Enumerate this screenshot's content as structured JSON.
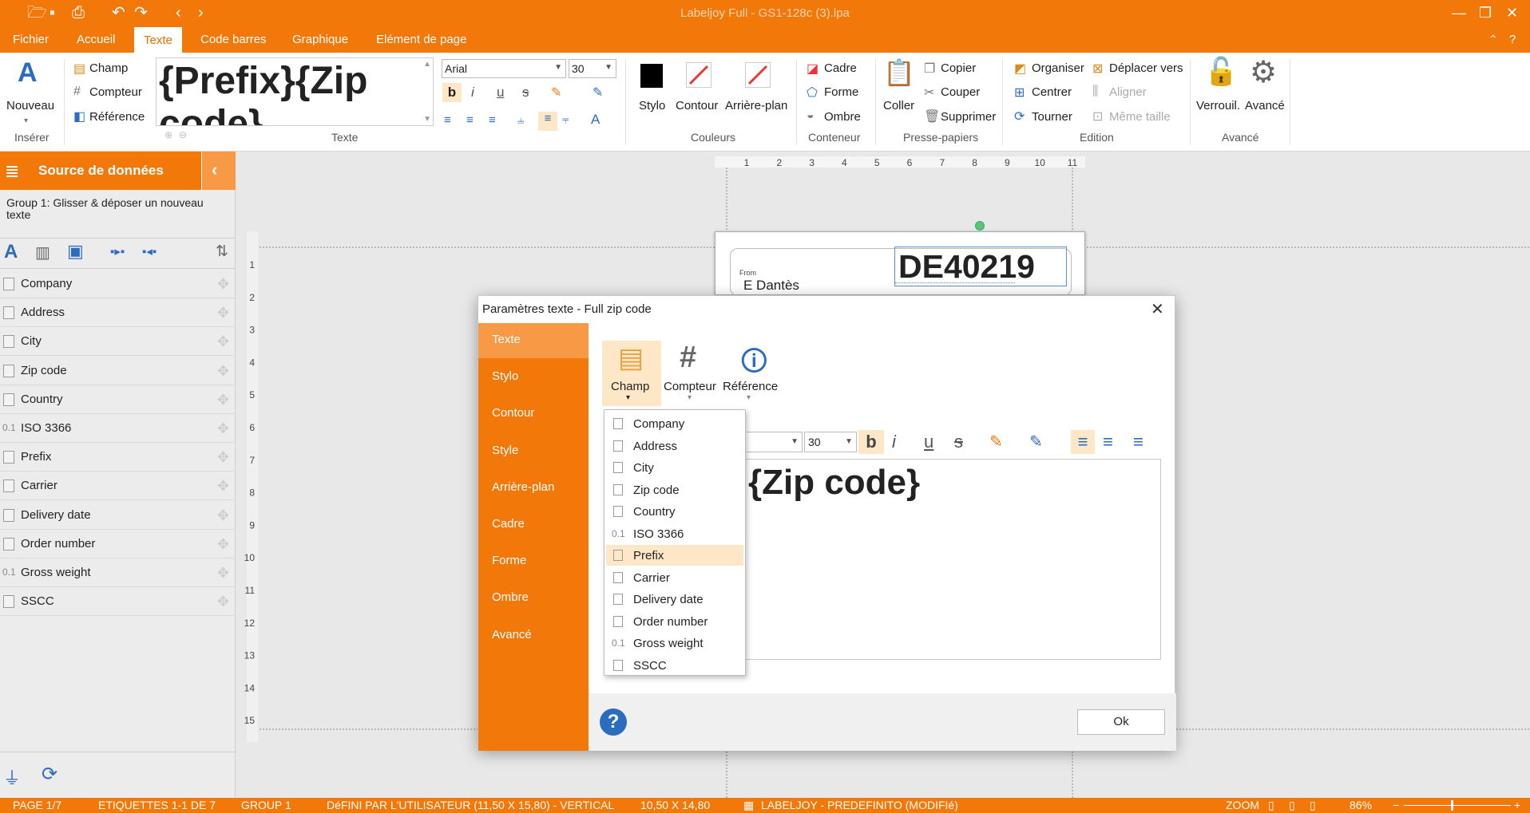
{
  "app": {
    "title": "Labeljoy Full - GS1-128c (3).lpa",
    "ribbon_tabs": [
      "Fichier",
      "Accueil",
      "Texte",
      "Code barres",
      "Graphique",
      "Elément de page"
    ],
    "active_tab": "Texte"
  },
  "ribbon": {
    "insert": {
      "nouveau": "Nouveau",
      "group": "Insérer"
    },
    "fields": {
      "champ": "Champ",
      "compteur": "Compteur",
      "reference": "Référence"
    },
    "texte": {
      "preview": "{Prefix}{Zip code}",
      "group": "Texte"
    },
    "font": {
      "name": "Arial",
      "size": "30"
    },
    "couleurs": {
      "stylo": "Stylo",
      "contour": "Contour",
      "arriere_plan": "Arrière-plan",
      "group": "Couleurs"
    },
    "conteneur": {
      "cadre": "Cadre",
      "forme": "Forme",
      "ombre": "Ombre",
      "group": "Conteneur"
    },
    "presse_papiers": {
      "coller": "Coller",
      "copier": "Copier",
      "couper": "Couper",
      "supprimer": "Supprimer",
      "group": "Presse-papiers"
    },
    "edition": {
      "organiser": "Organiser",
      "deplacer": "Déplacer vers",
      "centrer": "Centrer",
      "aligner": "Aligner",
      "tourner": "Tourner",
      "meme_taille": "Même taille",
      "group": "Edition"
    },
    "avance": {
      "verrouil": "Verrouil.",
      "avance": "Avancé",
      "group": "Avancé"
    }
  },
  "left_panel": {
    "title": "Source de données",
    "group_hint": "Group 1: Glisser & déposer un nouveau texte",
    "fields": [
      {
        "label": "Company",
        "icon": "field-icon"
      },
      {
        "label": "Address",
        "icon": "field-icon"
      },
      {
        "label": "City",
        "icon": "field-icon"
      },
      {
        "label": "Zip code",
        "icon": "field-icon"
      },
      {
        "label": "Country",
        "icon": "field-icon"
      },
      {
        "label": "ISO 3366",
        "icon": "0.1"
      },
      {
        "label": "Prefix",
        "icon": "field-icon"
      },
      {
        "label": "Carrier",
        "icon": "field-icon"
      },
      {
        "label": "Delivery date",
        "icon": "date-icon"
      },
      {
        "label": "Order number",
        "icon": "field-icon"
      },
      {
        "label": "Gross weight",
        "icon": "0.1"
      },
      {
        "label": "SSCC",
        "icon": "field-icon"
      }
    ]
  },
  "canvas": {
    "ruler_h": [
      "1",
      "2",
      "3",
      "4",
      "5",
      "6",
      "7",
      "8",
      "9",
      "10",
      "11"
    ],
    "ruler_v": [
      "1",
      "2",
      "3",
      "4",
      "5",
      "6",
      "7",
      "8",
      "9",
      "10",
      "11",
      "12",
      "13",
      "14",
      "15"
    ],
    "label": {
      "from_caption": "From",
      "sender": "E Dantès",
      "zip_value": "DE40219"
    }
  },
  "dialog": {
    "title": "Paramètres texte - Full zip code",
    "sidebar": [
      "Texte",
      "Stylo",
      "Contour",
      "Style",
      "Arrière-plan",
      "Cadre",
      "Forme",
      "Ombre",
      "Avancé"
    ],
    "selected_sidebar": "Texte",
    "toolbar": {
      "champ": "Champ",
      "compteur": "Compteur",
      "reference": "Référence"
    },
    "font_size": "30",
    "editor_text": "{Zip code}",
    "dropdown": [
      "Company",
      "Address",
      "City",
      "Zip code",
      "Country",
      "ISO 3366",
      "Prefix",
      "Carrier",
      "Delivery date",
      "Order number",
      "Gross weight",
      "SSCC"
    ],
    "dropdown_icons": [
      "field",
      "field",
      "field",
      "field",
      "field",
      "0.1",
      "field",
      "field",
      "date",
      "field",
      "0.1",
      "field"
    ],
    "dropdown_highlight": "Prefix",
    "ok_label": "Ok"
  },
  "status": {
    "page": "PAGE 1/7",
    "etiquettes": "ETIQUETTES 1-1 DE 7",
    "group": "GROUP 1",
    "defini": "DéFINI PAR L'UTILISATEUR (11,50 X 15,80) - VERTICAL",
    "size": "10,50 X 14,80",
    "template": "LABELJOY - PREDEFINITO (MODIFIé)",
    "zoom_label": "ZOOM",
    "zoom_value": "86%"
  },
  "colors": {
    "accent": "#f2780a",
    "highlight": "#fde7c6",
    "selected_side": "#f89a45"
  }
}
